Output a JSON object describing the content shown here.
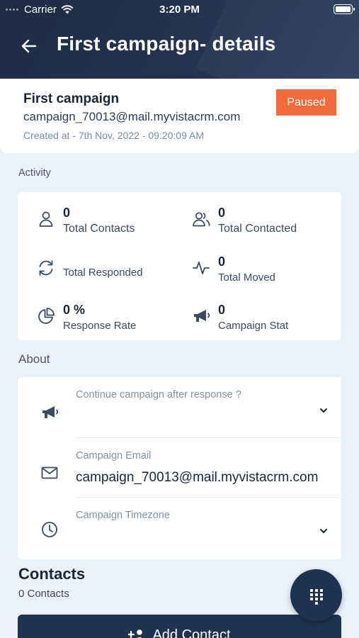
{
  "status_bar": {
    "carrier": "Carrier",
    "time": "3:20 PM"
  },
  "header": {
    "title": "First campaign- details"
  },
  "campaign": {
    "name": "First campaign",
    "email": "campaign_70013@mail.myvistacrm.com",
    "created": "Created at - 7th Nov, 2022 - 09:20:09 AM",
    "status": "Paused"
  },
  "activity": {
    "section_label": "Activity",
    "stats": [
      {
        "value": "0",
        "label": "Total Contacts",
        "icon": "user-icon"
      },
      {
        "value": "0",
        "label": "Total Contacted",
        "icon": "users-icon"
      },
      {
        "value": "",
        "label": "Total Responded",
        "icon": "refresh-icon"
      },
      {
        "value": "0",
        "label": "Total Moved",
        "icon": "activity-pulse-icon"
      },
      {
        "value": "0 %",
        "label": "Response Rate",
        "icon": "pie-chart-icon"
      },
      {
        "value": "0",
        "label": "Campaign Stat",
        "icon": "megaphone-icon"
      }
    ]
  },
  "about": {
    "section_label": "About",
    "continue_label": "Continue campaign after response ?",
    "continue_value": "",
    "email_label": "Campaign Email",
    "email_value": "campaign_70013@mail.myvistacrm.com",
    "timezone_label": "Campaign Timezone",
    "timezone_value": ""
  },
  "contacts": {
    "title": "Contacts",
    "count": "0 Contacts",
    "add_button": "Add Contact"
  },
  "colors": {
    "header": "#1e3350",
    "badge": "#f26b3a",
    "background": "#eaf1f9"
  }
}
